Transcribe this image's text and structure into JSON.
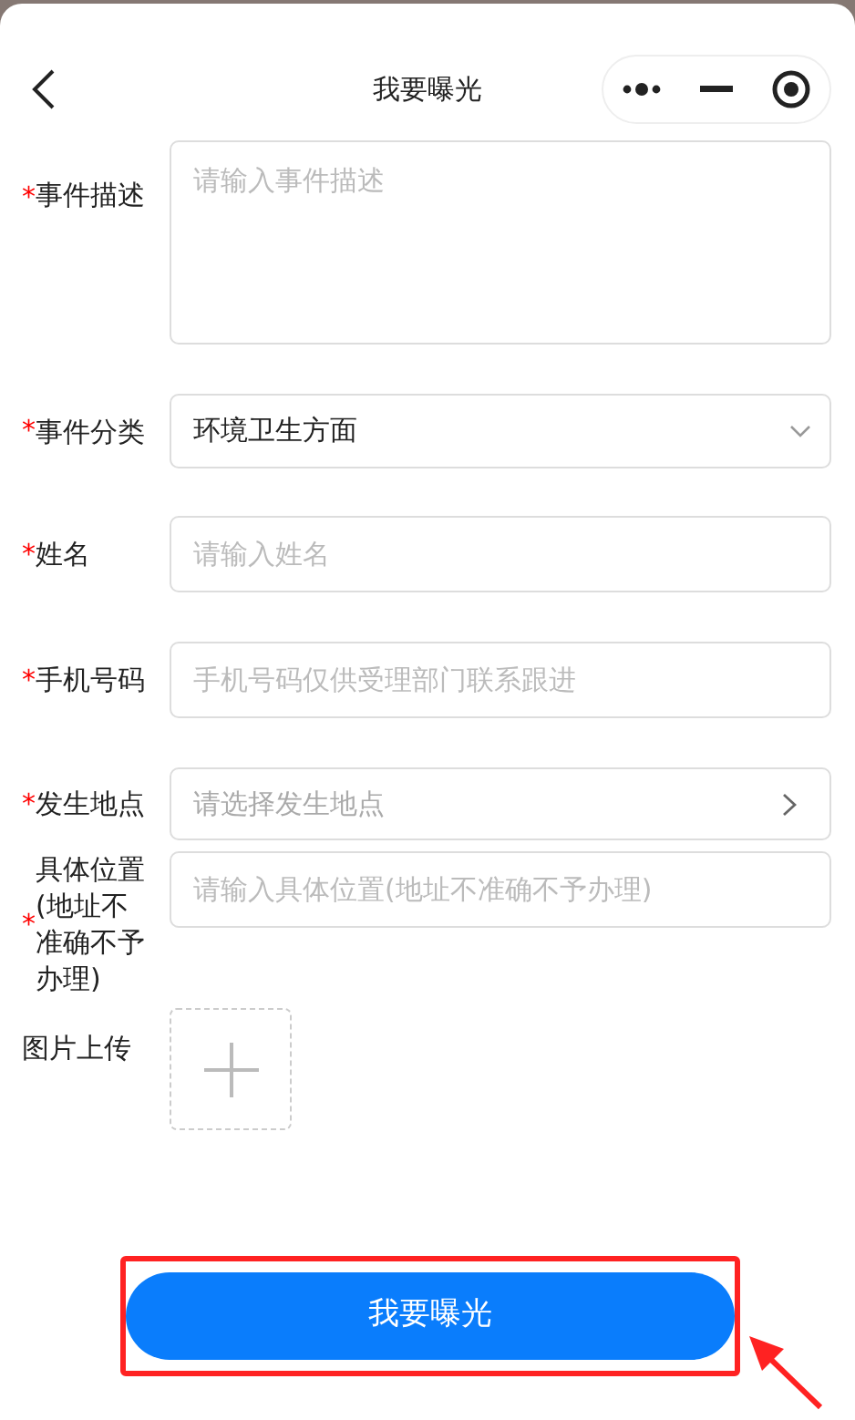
{
  "header": {
    "title": "我要曝光"
  },
  "fields": [
    {
      "kind": "textarea",
      "label": "事件描述",
      "required_mark": "*",
      "placeholder": "请输入事件描述"
    },
    {
      "kind": "select",
      "label": "事件分类",
      "required_mark": "*",
      "value": "环境卫生方面"
    },
    {
      "kind": "input",
      "label": "姓名",
      "required_mark": "*",
      "placeholder": "请输入姓名"
    },
    {
      "kind": "input",
      "label": "手机号码",
      "required_mark": "*",
      "placeholder": "手机号码仅供受理部门联系跟进"
    },
    {
      "kind": "picker",
      "label": "发生地点",
      "required_mark": "*",
      "placeholder": "请选择发生地点"
    },
    {
      "kind": "input",
      "label": "具体位置(地址不准确不予办理)",
      "required_mark": "*",
      "placeholder": "请输入具体位置(地址不准确不予办理)"
    },
    {
      "kind": "upload",
      "label": "图片上传"
    }
  ],
  "submit": {
    "label": "我要曝光",
    "highlighted": true
  }
}
